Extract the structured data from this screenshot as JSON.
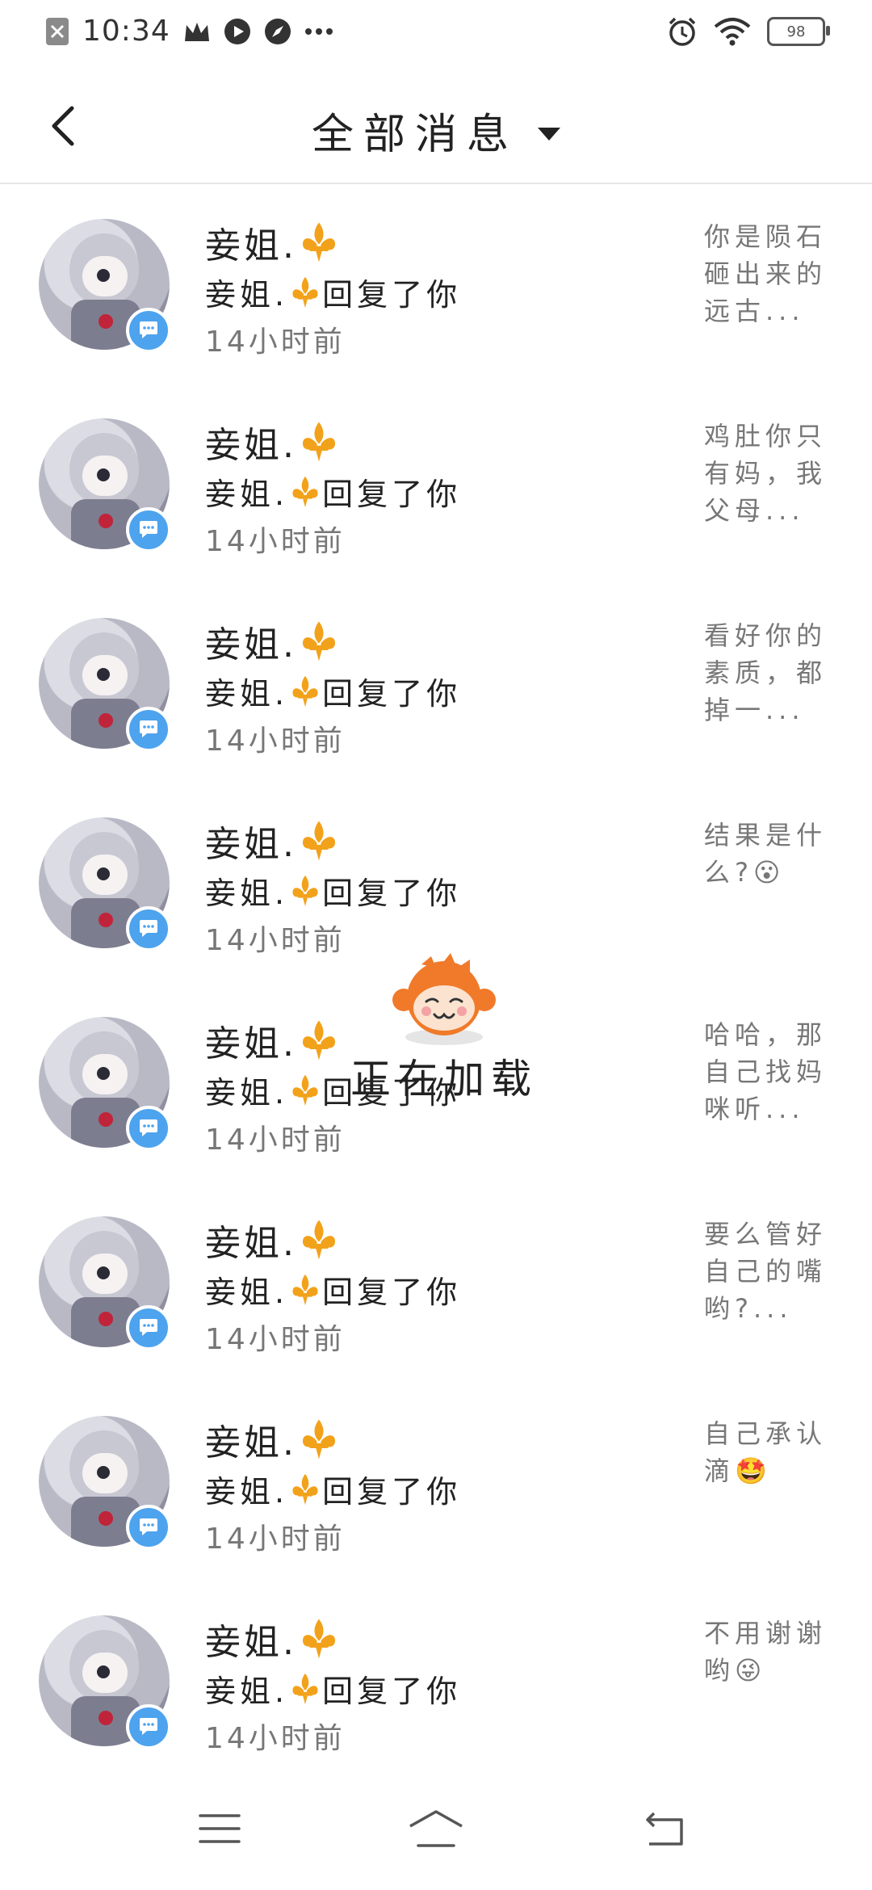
{
  "status_bar": {
    "time": "10:34",
    "battery": "98",
    "icons": [
      "close-box-icon",
      "crown-icon",
      "play-icon",
      "compass-icon",
      "more-dots-icon",
      "alarm-icon",
      "wifi-icon",
      "battery-icon"
    ]
  },
  "header": {
    "title": "全部消息",
    "back_icon": "back-arrow-icon",
    "dropdown_icon": "caret-down-icon"
  },
  "messages": [
    {
      "name": "妾姐.",
      "action": "妾姐. 回复了你",
      "time": "14小时前",
      "quote": "你是陨石砸出来的远古..."
    },
    {
      "name": "妾姐.",
      "action": "妾姐. 回复了你",
      "time": "14小时前",
      "quote": "鸡肚你只有妈，我父母..."
    },
    {
      "name": "妾姐.",
      "action": "妾姐. 回复了你",
      "time": "14小时前",
      "quote": "看好你的素质，都掉一..."
    },
    {
      "name": "妾姐.",
      "action": "妾姐. 回复了你",
      "time": "14小时前",
      "quote": "结果是什么?😮"
    },
    {
      "name": "妾姐.",
      "action": "妾姐. 回复了你",
      "time": "14小时前",
      "quote": "哈哈，那自己找妈咪听..."
    },
    {
      "name": "妾姐.",
      "action": "妾姐. 回复了你",
      "time": "14小时前",
      "quote": "要么管好自己的嘴哟?..."
    },
    {
      "name": "妾姐.",
      "action": "妾姐. 回复了你",
      "time": "14小时前",
      "quote": "自己承认滴🤩"
    },
    {
      "name": "妾姐.",
      "action": "妾姐. 回复了你",
      "time": "14小时前",
      "quote": "不用谢谢哟😜"
    }
  ],
  "name_prefix": "妾姐.",
  "action_suffix": "回复了你",
  "loading": {
    "text": "正在加载"
  },
  "colors": {
    "fleur": "#f2a21a",
    "badge": "#4da3ee",
    "muted": "#777777"
  }
}
